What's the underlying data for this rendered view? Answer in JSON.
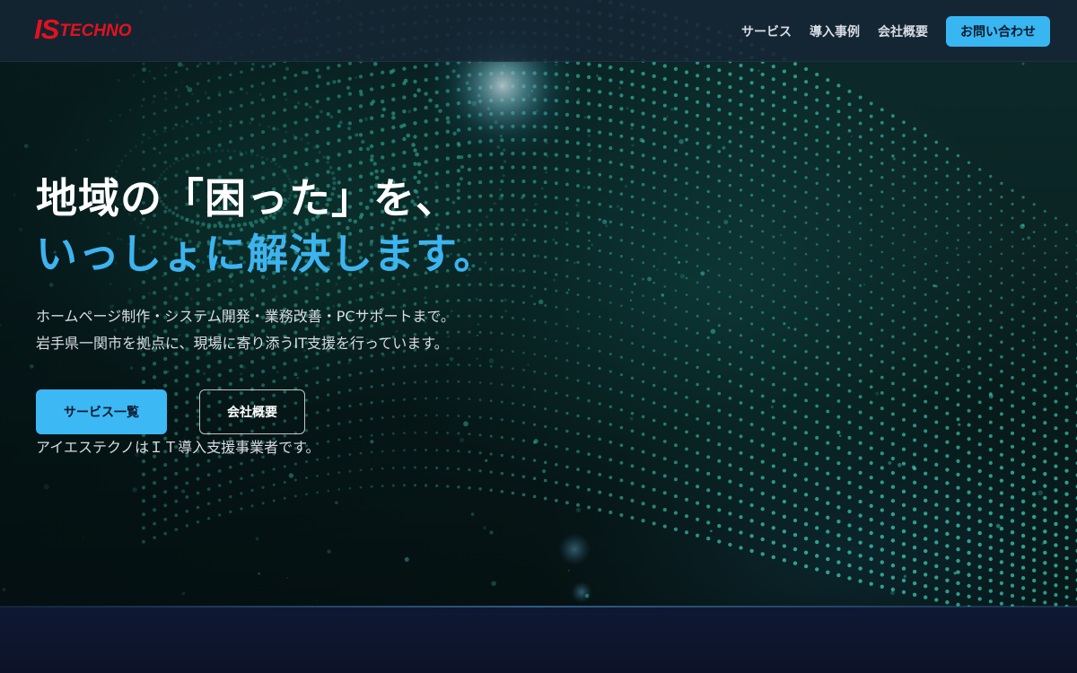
{
  "brand": {
    "logo_is": "IS",
    "logo_techno": "TECHNO",
    "logo_color": "#e3121e"
  },
  "nav": {
    "items": [
      {
        "label": "サービス"
      },
      {
        "label": "導入事例"
      },
      {
        "label": "会社概要"
      }
    ],
    "cta_label": "お問い合わせ"
  },
  "hero": {
    "headline_line1": "地域の「困った」を、",
    "headline_line2": "いっしょに解決します。",
    "lead_line1": "ホームページ制作・システム開発・業務改善・PCサポートまで。",
    "lead_line2": "岩手県一関市を拠点に、現場に寄り添うIT支援を行っています。",
    "primary_button": "サービス一覧",
    "secondary_button": "会社概要",
    "tagline": "アイエステクノはＩＴ導入支援事業者です。"
  },
  "colors": {
    "accent": "#38b6f2",
    "headline_accent": "#3cb4f0",
    "header_bg": "#162634",
    "footer_bg": "#0f1833",
    "particles": "#3fd8c0"
  },
  "icons": {
    "hero_background": "particle-wave-image"
  }
}
